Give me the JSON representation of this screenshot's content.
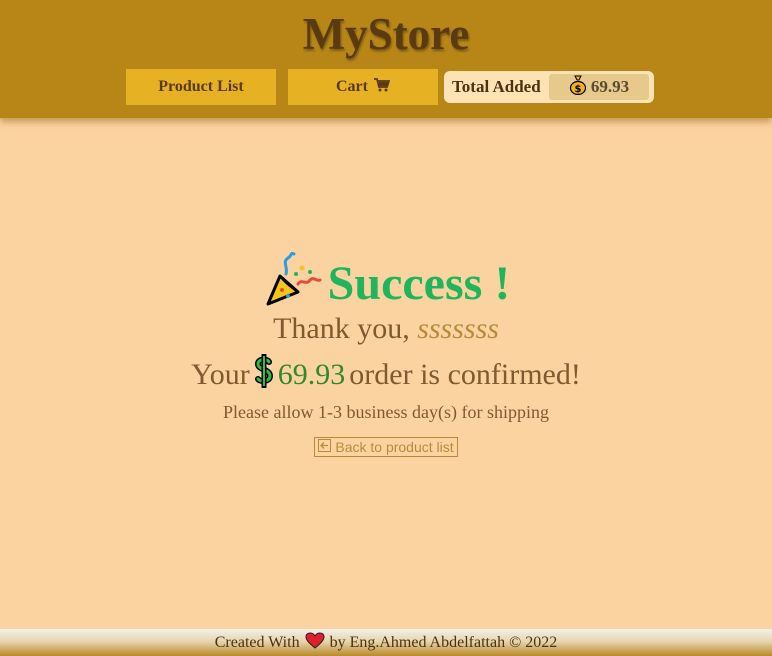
{
  "header": {
    "brand": "MyStore",
    "nav": {
      "product_list_label": "Product List",
      "cart_label": "Cart"
    },
    "total": {
      "label": "Total Added",
      "amount": "69.93"
    }
  },
  "main": {
    "title": "Success !",
    "thanks_prefix": "Thank you,",
    "customer_name": "sssssss",
    "confirm_prefix": "Your",
    "amount": "69.93",
    "confirm_suffix": "order is confirmed!",
    "shipping_note": "Please allow 1-3 business day(s) for shipping",
    "back_link": "Back to product list"
  },
  "footer": {
    "created_with": "Created With",
    "by_text": "by Eng.Ahmed Abdelfattah © 2022"
  },
  "colors": {
    "header_bg": "#b78617",
    "page_bg": "#fbd3a1",
    "success": "#20b55a",
    "button_bg": "#e6b224"
  },
  "icons": [
    "cart-icon",
    "money-bag-icon",
    "party-popper-icon",
    "dollar-icon",
    "arrow-left-icon",
    "heart-icon"
  ]
}
